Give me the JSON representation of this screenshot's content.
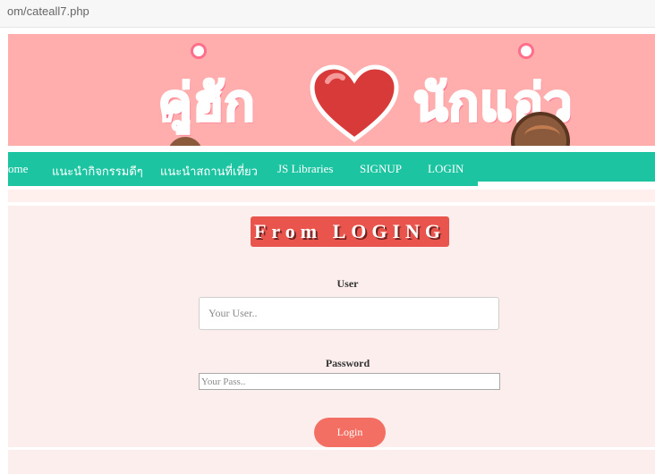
{
  "browser": {
    "url_fragment": "om/cateall7.php"
  },
  "banner": {
    "title_left": "คู่ฮัก",
    "title_right": "นักแอ่ว",
    "background": "#ffadad",
    "title_color": "#ff6f8a"
  },
  "nav": {
    "background": "#1dc4a2",
    "items": [
      {
        "label": "ome"
      },
      {
        "label": "แนะนำกิจกรรมดีๆ"
      },
      {
        "label": "แนะนำสถานที่เที่ยว"
      },
      {
        "label": "JS Libraries"
      },
      {
        "label": "SIGNUP"
      },
      {
        "label": "LOGIN"
      }
    ]
  },
  "form": {
    "title": "From LOGING",
    "user_label": "User",
    "user_placeholder": "Your User..",
    "password_label": "Password",
    "password_placeholder": "Your Pass..",
    "login_button": "Login",
    "title_bg": "#e9544c",
    "button_bg": "#f46f63",
    "panel_bg": "#fdeeee"
  }
}
